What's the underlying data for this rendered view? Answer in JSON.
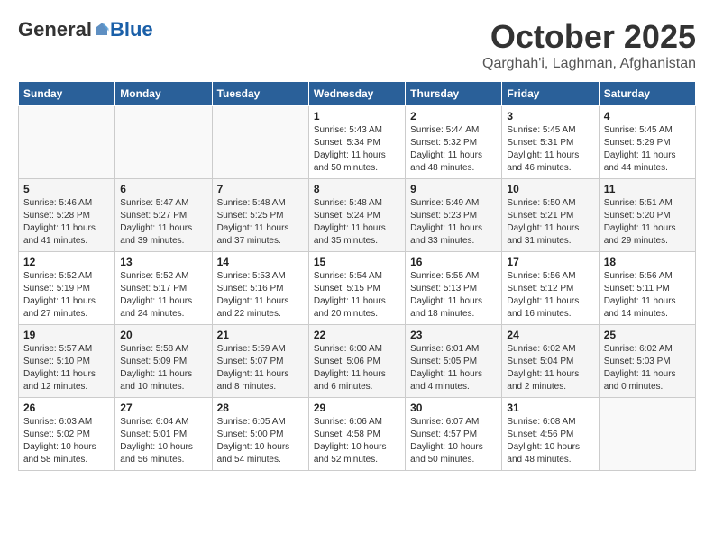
{
  "header": {
    "logo_general": "General",
    "logo_blue": "Blue",
    "month": "October 2025",
    "location": "Qarghah'i, Laghman, Afghanistan"
  },
  "calendar": {
    "days_of_week": [
      "Sunday",
      "Monday",
      "Tuesday",
      "Wednesday",
      "Thursday",
      "Friday",
      "Saturday"
    ],
    "weeks": [
      [
        {
          "day": "",
          "info": ""
        },
        {
          "day": "",
          "info": ""
        },
        {
          "day": "",
          "info": ""
        },
        {
          "day": "1",
          "info": "Sunrise: 5:43 AM\nSunset: 5:34 PM\nDaylight: 11 hours and 50 minutes."
        },
        {
          "day": "2",
          "info": "Sunrise: 5:44 AM\nSunset: 5:32 PM\nDaylight: 11 hours and 48 minutes."
        },
        {
          "day": "3",
          "info": "Sunrise: 5:45 AM\nSunset: 5:31 PM\nDaylight: 11 hours and 46 minutes."
        },
        {
          "day": "4",
          "info": "Sunrise: 5:45 AM\nSunset: 5:29 PM\nDaylight: 11 hours and 44 minutes."
        }
      ],
      [
        {
          "day": "5",
          "info": "Sunrise: 5:46 AM\nSunset: 5:28 PM\nDaylight: 11 hours and 41 minutes."
        },
        {
          "day": "6",
          "info": "Sunrise: 5:47 AM\nSunset: 5:27 PM\nDaylight: 11 hours and 39 minutes."
        },
        {
          "day": "7",
          "info": "Sunrise: 5:48 AM\nSunset: 5:25 PM\nDaylight: 11 hours and 37 minutes."
        },
        {
          "day": "8",
          "info": "Sunrise: 5:48 AM\nSunset: 5:24 PM\nDaylight: 11 hours and 35 minutes."
        },
        {
          "day": "9",
          "info": "Sunrise: 5:49 AM\nSunset: 5:23 PM\nDaylight: 11 hours and 33 minutes."
        },
        {
          "day": "10",
          "info": "Sunrise: 5:50 AM\nSunset: 5:21 PM\nDaylight: 11 hours and 31 minutes."
        },
        {
          "day": "11",
          "info": "Sunrise: 5:51 AM\nSunset: 5:20 PM\nDaylight: 11 hours and 29 minutes."
        }
      ],
      [
        {
          "day": "12",
          "info": "Sunrise: 5:52 AM\nSunset: 5:19 PM\nDaylight: 11 hours and 27 minutes."
        },
        {
          "day": "13",
          "info": "Sunrise: 5:52 AM\nSunset: 5:17 PM\nDaylight: 11 hours and 24 minutes."
        },
        {
          "day": "14",
          "info": "Sunrise: 5:53 AM\nSunset: 5:16 PM\nDaylight: 11 hours and 22 minutes."
        },
        {
          "day": "15",
          "info": "Sunrise: 5:54 AM\nSunset: 5:15 PM\nDaylight: 11 hours and 20 minutes."
        },
        {
          "day": "16",
          "info": "Sunrise: 5:55 AM\nSunset: 5:13 PM\nDaylight: 11 hours and 18 minutes."
        },
        {
          "day": "17",
          "info": "Sunrise: 5:56 AM\nSunset: 5:12 PM\nDaylight: 11 hours and 16 minutes."
        },
        {
          "day": "18",
          "info": "Sunrise: 5:56 AM\nSunset: 5:11 PM\nDaylight: 11 hours and 14 minutes."
        }
      ],
      [
        {
          "day": "19",
          "info": "Sunrise: 5:57 AM\nSunset: 5:10 PM\nDaylight: 11 hours and 12 minutes."
        },
        {
          "day": "20",
          "info": "Sunrise: 5:58 AM\nSunset: 5:09 PM\nDaylight: 11 hours and 10 minutes."
        },
        {
          "day": "21",
          "info": "Sunrise: 5:59 AM\nSunset: 5:07 PM\nDaylight: 11 hours and 8 minutes."
        },
        {
          "day": "22",
          "info": "Sunrise: 6:00 AM\nSunset: 5:06 PM\nDaylight: 11 hours and 6 minutes."
        },
        {
          "day": "23",
          "info": "Sunrise: 6:01 AM\nSunset: 5:05 PM\nDaylight: 11 hours and 4 minutes."
        },
        {
          "day": "24",
          "info": "Sunrise: 6:02 AM\nSunset: 5:04 PM\nDaylight: 11 hours and 2 minutes."
        },
        {
          "day": "25",
          "info": "Sunrise: 6:02 AM\nSunset: 5:03 PM\nDaylight: 11 hours and 0 minutes."
        }
      ],
      [
        {
          "day": "26",
          "info": "Sunrise: 6:03 AM\nSunset: 5:02 PM\nDaylight: 10 hours and 58 minutes."
        },
        {
          "day": "27",
          "info": "Sunrise: 6:04 AM\nSunset: 5:01 PM\nDaylight: 10 hours and 56 minutes."
        },
        {
          "day": "28",
          "info": "Sunrise: 6:05 AM\nSunset: 5:00 PM\nDaylight: 10 hours and 54 minutes."
        },
        {
          "day": "29",
          "info": "Sunrise: 6:06 AM\nSunset: 4:58 PM\nDaylight: 10 hours and 52 minutes."
        },
        {
          "day": "30",
          "info": "Sunrise: 6:07 AM\nSunset: 4:57 PM\nDaylight: 10 hours and 50 minutes."
        },
        {
          "day": "31",
          "info": "Sunrise: 6:08 AM\nSunset: 4:56 PM\nDaylight: 10 hours and 48 minutes."
        },
        {
          "day": "",
          "info": ""
        }
      ]
    ]
  }
}
